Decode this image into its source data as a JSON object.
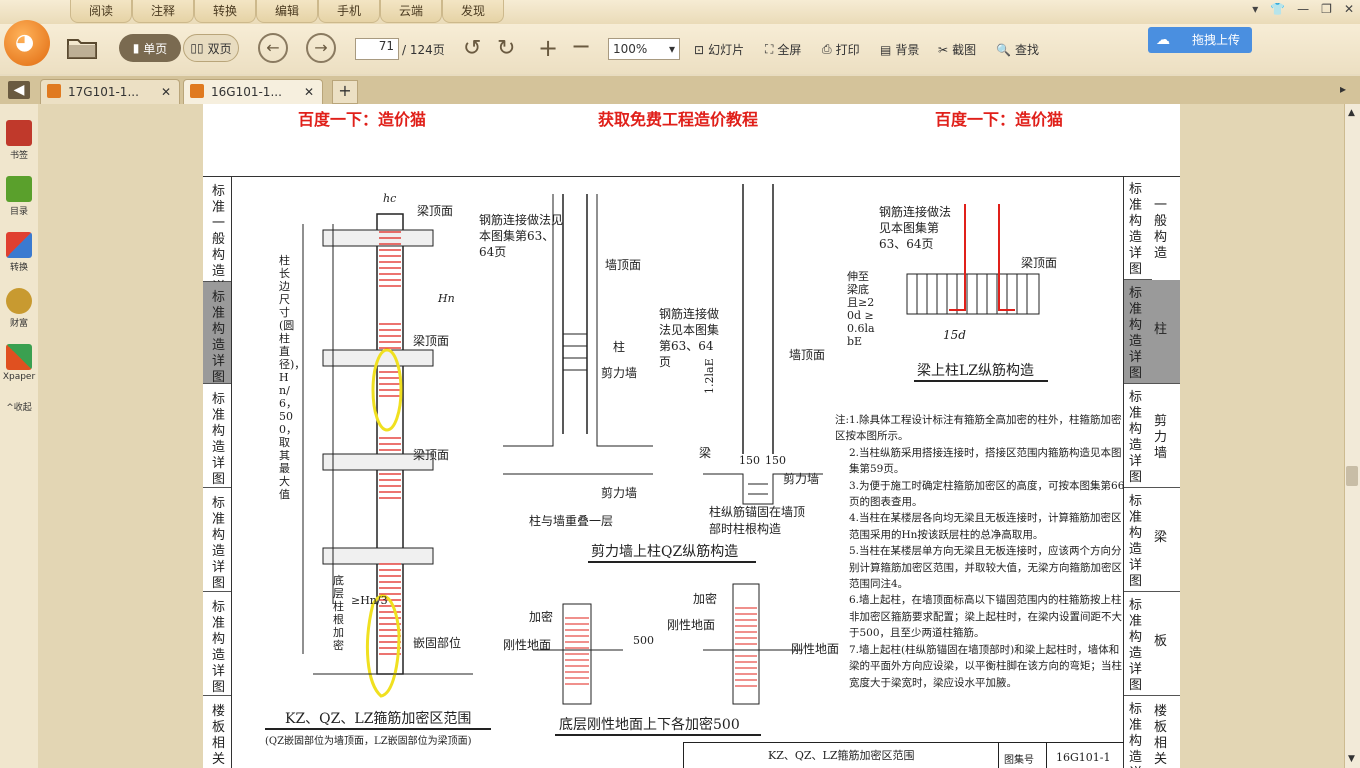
{
  "menu": {
    "items": [
      "阅读",
      "注释",
      "转换",
      "编辑",
      "手机",
      "云端",
      "发现"
    ]
  },
  "toolbar": {
    "single_page": "单页",
    "double_page": "双页",
    "page_current": "71",
    "page_total": "/ 124页",
    "zoom": "100%",
    "slideshow": "幻灯片",
    "fullscreen": "全屏",
    "print": "打印",
    "background": "背景",
    "screenshot": "截图",
    "find": "查找",
    "upload": "拖拽上传"
  },
  "tabs": [
    {
      "label": "17G101-1..."
    },
    {
      "label": "16G101-1..."
    }
  ],
  "sidebar": {
    "items": [
      {
        "label": "书签",
        "icon": "bookmark-icon",
        "color": "#c0392b"
      },
      {
        "label": "目录",
        "icon": "toc-icon",
        "color": "#5aa02c"
      },
      {
        "label": "转换",
        "icon": "convert-icon",
        "color": "#e04030"
      },
      {
        "label": "财富",
        "icon": "money-icon",
        "color": "#c89a30"
      },
      {
        "label": "Xpaper",
        "icon": "xpaper-icon",
        "color": "#e05020"
      }
    ],
    "collapse": "^收起"
  },
  "page": {
    "header_left": "百度一下：造价猫",
    "header_center": "获取免费工程造价教程",
    "header_right": "百度一下：造价猫",
    "left_tabs": [
      "标准一般构造详图",
      "标准构造详图",
      "标准构造详图",
      "标准构造详图",
      "标准构造详图",
      "楼板相关构造"
    ],
    "right_tabs": [
      {
        "text": "标准构造详图",
        "side": "一般构造",
        "active": false
      },
      {
        "text": "标准构造详图",
        "side": "柱",
        "active": true
      },
      {
        "text": "标准构造详图",
        "side": "剪力墙",
        "active": false
      },
      {
        "text": "标准构造详图",
        "side": "梁",
        "active": false
      },
      {
        "text": "标准构造详图",
        "side": "板",
        "active": false
      },
      {
        "text": "标准构造详图",
        "side": "楼板相关",
        "active": false
      }
    ],
    "fig1_title": "KZ、QZ、LZ箍筋加密区范围",
    "fig1_sub": "(QZ嵌固部位为墙顶面，LZ嵌固部位为梁顶面)",
    "fig1_labels": {
      "beam_top1": "梁顶面",
      "beam_top2": "梁顶面",
      "beam_top3": "梁顶面",
      "jiami": "加密",
      "hc": "hc",
      "hn": "Hn",
      "side_note": "柱长边尺寸(圆柱直径)，Hn/6，500，取其最大值",
      "bottom_note": "底层柱根加密",
      "hn3": "≥Hn/3",
      "embed": "嵌固部位"
    },
    "fig2_title": "剪力墙上柱QZ纵筋构造",
    "fig2_labels": {
      "rebar_note": "钢筋连接做法见本图集第63、64页",
      "wall_top": "墙顶面",
      "column": "柱",
      "shear_wall": "剪力墙",
      "caption_a": "柱与墙重叠一层",
      "rebar_note2": "钢筋连接做法见本图集第63、64页",
      "wall_top2": "墙顶面",
      "beam": "梁",
      "d150a": "150",
      "d150b": "150",
      "shear_wall2": "剪力墙",
      "lae": "1.2laE",
      "caption_b": "柱纵筋锚固在墙顶部时柱根构造"
    },
    "fig3_title": "梁上柱LZ纵筋构造",
    "fig3_labels": {
      "rebar_note": "钢筋连接做法见本图集第63、64页",
      "beam_top": "梁顶面",
      "anchor": "伸至梁底且≥20d ≥0.6labE",
      "d15": "15d"
    },
    "fig4_title": "底层刚性地面上下各加密500",
    "fig4_labels": {
      "jiami": "加密",
      "rigid_ground": "刚性地面",
      "d500": "500",
      "jiami2": "加密",
      "rigid_ground2": "刚性地面",
      "rigid_ground3": "刚性地面"
    },
    "notes": [
      "注:1.除具体工程设计标注有箍筋全高加密的柱外，柱箍筋加密区按本图所示。",
      "2.当柱纵筋采用搭接连接时，搭接区范围内箍筋构造见本图集第59页。",
      "3.为便于施工时确定柱箍筋加密区的高度，可按本图集第66页的图表查用。",
      "4.当柱在某楼层各向均无梁且无板连接时，计算箍筋加密区范围采用的Hn按该跃层柱的总净高取用。",
      "5.当柱在某楼层单方向无梁且无板连接时，应该两个方向分别计算箍筋加密区范围，并取较大值，无梁方向箍筋加密区范围同注4。",
      "6.墙上起柱，在墙顶面标高以下锚固范围内的柱箍筋按上柱非加密区箍筋要求配置；梁上起柱时，在梁内设置间距不大于500，且至少两道柱箍筋。",
      "7.墙上起柱(柱纵筋锚固在墙顶部时)和梁上起柱时，墙体和梁的平面外方向应设梁，以平衡柱脚在该方向的弯矩；当柱宽度大于梁宽时，梁应设水平加腋。"
    ],
    "footer_title": "KZ、QZ、LZ箍筋加密区范围",
    "footer_label": "图集号",
    "footer_code": "16G101-1"
  }
}
